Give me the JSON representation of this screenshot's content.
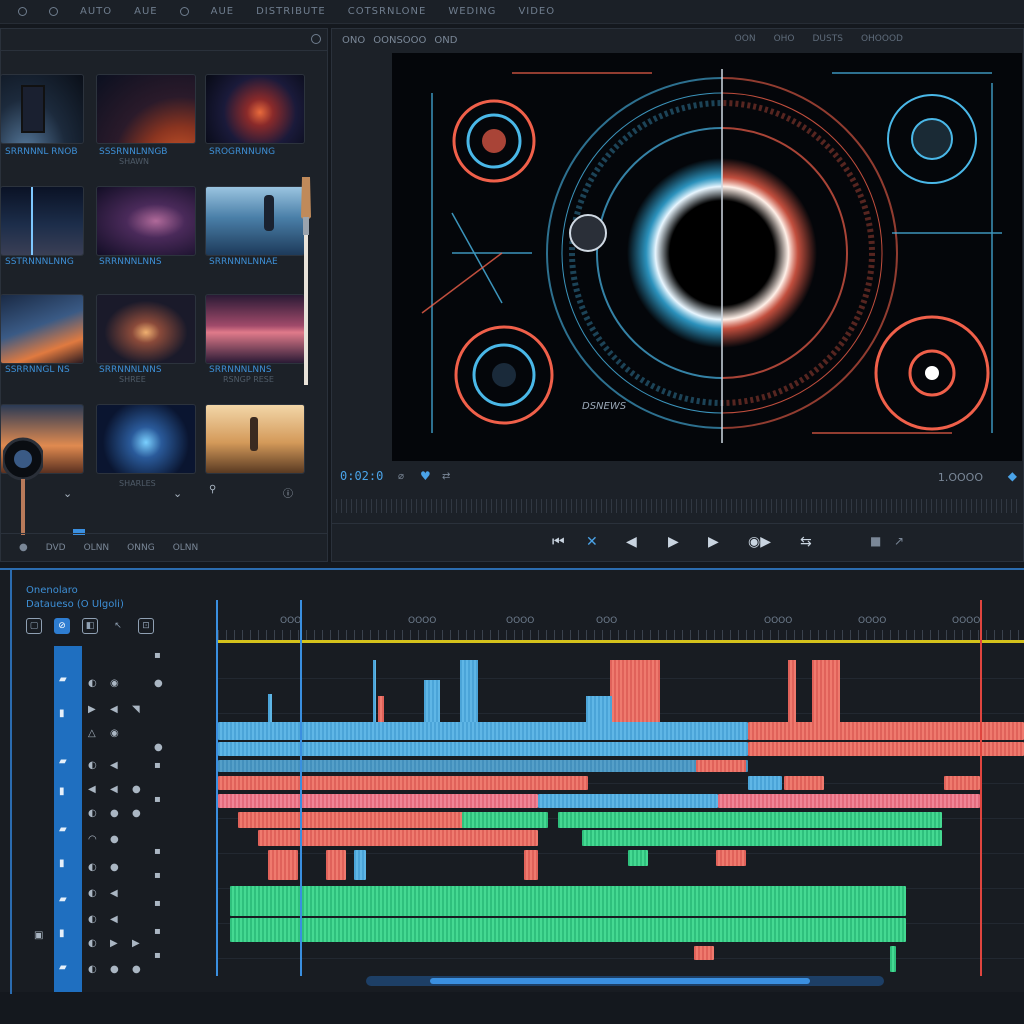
{
  "menu": [
    "AUTO",
    "AUE",
    "AUE",
    "DISTRIBUTE",
    "COTSRNLONE",
    "WEDING",
    "VIDEO"
  ],
  "media": {
    "thumbs": [
      {
        "cap": "SRRNNNL RNOB",
        "sub": ""
      },
      {
        "cap": "SSSRNNLNNGB",
        "sub": "SHAWN"
      },
      {
        "cap": "SROGRNNUNG",
        "sub": ""
      },
      {
        "cap": "SSTRNNNLNNG",
        "sub": ""
      },
      {
        "cap": "SRRNNNLNNS",
        "sub": ""
      },
      {
        "cap": "SRRNNNLNNAE",
        "sub": ""
      },
      {
        "cap": "SSRRNNGL NS",
        "sub": ""
      },
      {
        "cap": "SRRNNNLNNS",
        "sub": "SHREE"
      },
      {
        "cap": "SRRNNNLNNS",
        "sub": "RSNGP RESE"
      },
      {
        "cap": "",
        "sub": ""
      },
      {
        "cap": "",
        "sub": "SHARLES"
      },
      {
        "cap": "",
        "sub": ""
      }
    ],
    "footer": [
      "DVD",
      "OLNN",
      "ONNG",
      "OLNN"
    ]
  },
  "preview": {
    "head": [
      "ONO",
      "OONSOOO",
      "OND"
    ],
    "head_right": [
      "OON",
      "OHO",
      "DUSTS",
      "OHOOOD"
    ],
    "timecode": "0:02:0",
    "duration": "1.OOOO",
    "viewer_label": "DSNEWS"
  },
  "timeline": {
    "title": "Onenolaro",
    "subtitle": "Dataueso (O Ulgoli)",
    "ruler_labels": [
      "OOO",
      "OOOO",
      "OOOO",
      "OOO",
      "OOOO",
      "OOOO",
      "OOOO"
    ]
  },
  "colors": {
    "accent": "#2e7dd1",
    "clip_blue": "#4ba4d8",
    "clip_red": "#e0625a",
    "clip_green": "#2fc07d",
    "playhead_red": "#e0453f",
    "ruler_yellow": "#d4c21c"
  }
}
